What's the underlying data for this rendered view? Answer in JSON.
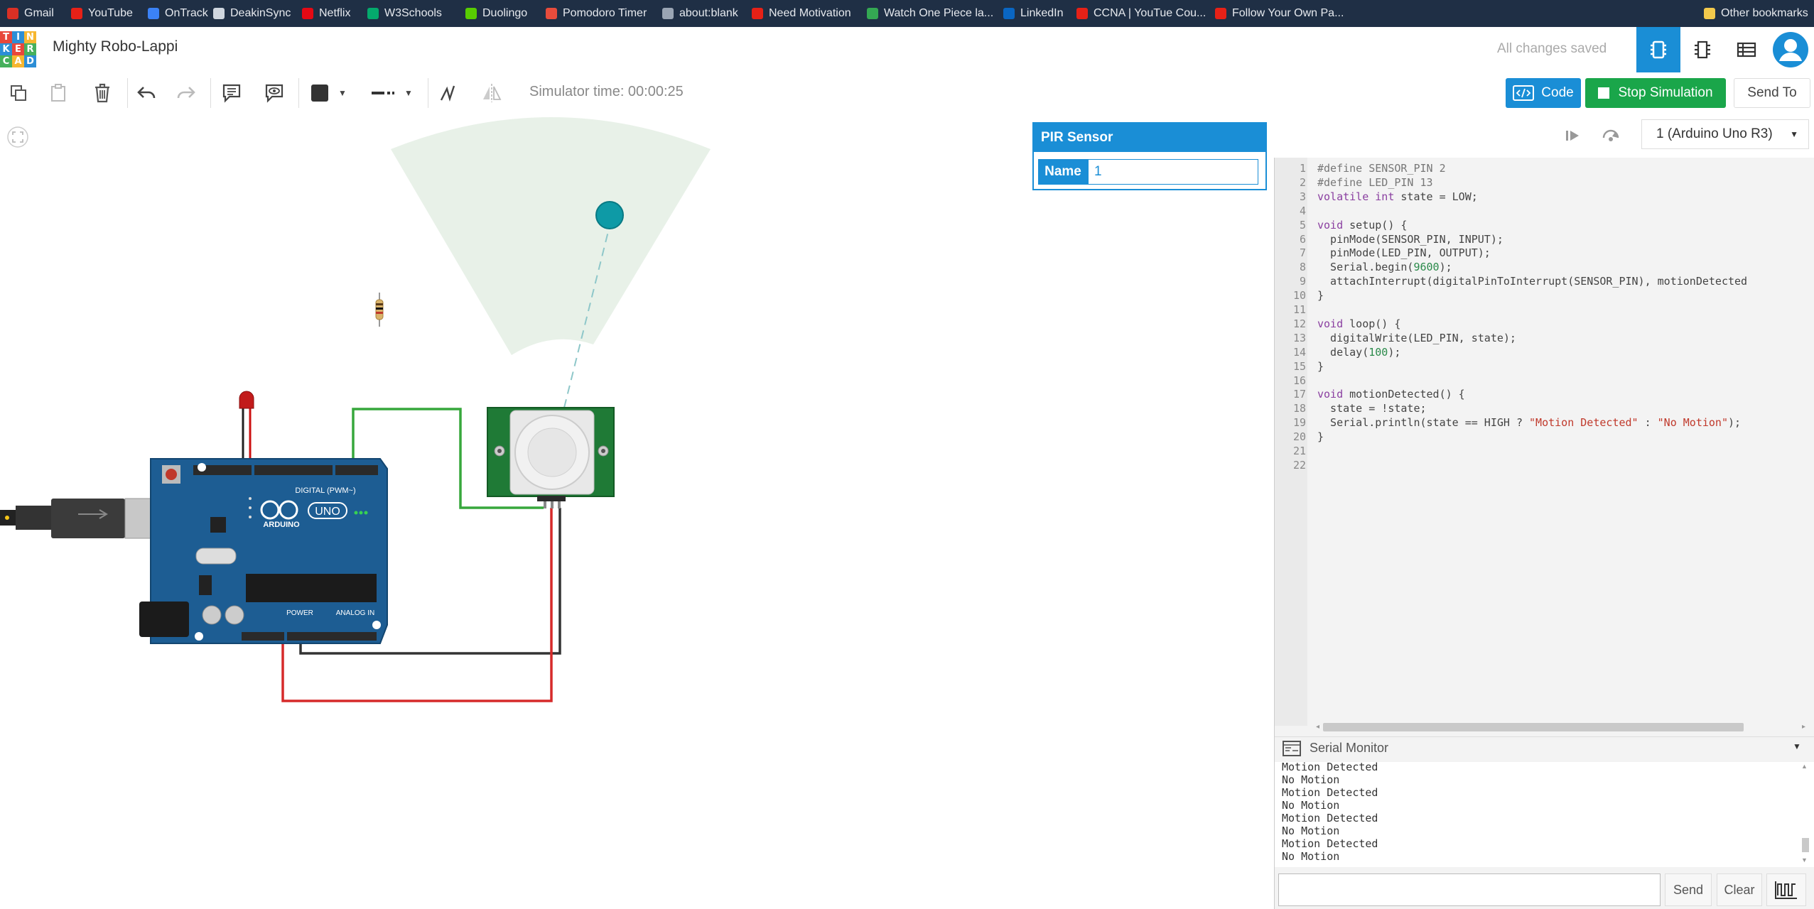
{
  "bookmarks": [
    {
      "label": "Gmail",
      "icon": "gmail-icon",
      "color": "#d93025"
    },
    {
      "label": "YouTube",
      "icon": "youtube-icon",
      "color": "#e62117"
    },
    {
      "label": "OnTrack",
      "icon": "ontrack-icon",
      "color": "#3b82f6"
    },
    {
      "label": "DeakinSync",
      "icon": "deakinsync-icon",
      "color": "#cfd6df"
    },
    {
      "label": "Netflix",
      "icon": "netflix-icon",
      "color": "#e50914"
    },
    {
      "label": "W3Schools",
      "icon": "w3schools-icon",
      "color": "#04aa6d"
    },
    {
      "label": "Duolingo",
      "icon": "duolingo-icon",
      "color": "#58cc02"
    },
    {
      "label": "Pomodoro Timer",
      "icon": "pomodoro-icon",
      "color": "#e74c3c"
    },
    {
      "label": "about:blank",
      "icon": "globe-icon",
      "color": "#9aa5b4"
    },
    {
      "label": "Need Motivation",
      "icon": "youtube-icon",
      "color": "#e62117"
    },
    {
      "label": "Watch One Piece la...",
      "icon": "bookmark-page-icon",
      "color": "#34a853"
    },
    {
      "label": "LinkedIn",
      "icon": "linkedin-icon",
      "color": "#0a66c2"
    },
    {
      "label": "CCNA | YouTue Cou...",
      "icon": "youtube-icon",
      "color": "#e62117"
    },
    {
      "label": "Follow Your Own Pa...",
      "icon": "youtube-icon",
      "color": "#e62117"
    }
  ],
  "other_bookmarks": "Other bookmarks",
  "logo_letters": [
    "T",
    "I",
    "N",
    "K",
    "E",
    "R",
    "C",
    "A",
    "D"
  ],
  "project_title": "Mighty Robo-Lappi",
  "saved_status": "All changes saved",
  "simulator_time": "Simulator time: 00:00:25",
  "buttons": {
    "code": "Code",
    "stop_simulation": "Stop Simulation",
    "send_to": "Send To"
  },
  "inspector": {
    "title": "PIR Sensor",
    "name_label": "Name",
    "name_value": "1"
  },
  "board_labels": {
    "digital": "DIGITAL (PWM~)",
    "uno": "UNO",
    "arduino": "ARDUINO",
    "power": "POWER",
    "analog": "ANALOG IN"
  },
  "device_select": "1 (Arduino Uno R3)",
  "code_lines": [
    "#define SENSOR_PIN 2",
    "#define LED_PIN 13",
    "volatile int state = LOW;",
    "",
    "void setup() {",
    "  pinMode(SENSOR_PIN, INPUT);",
    "  pinMode(LED_PIN, OUTPUT);",
    "  Serial.begin(9600);",
    "  attachInterrupt(digitalPinToInterrupt(SENSOR_PIN), motionDetected",
    "}",
    "",
    "void loop() {",
    "  digitalWrite(LED_PIN, state);",
    "  delay(100);",
    "}",
    "",
    "void motionDetected() {",
    "  state = !state;",
    "  Serial.println(state == HIGH ? \"Motion Detected\" : \"No Motion\");",
    "}",
    "",
    ""
  ],
  "serial_monitor": {
    "title": "Serial Monitor",
    "lines": [
      "Motion Detected",
      "No Motion",
      "Motion Detected",
      "No Motion",
      "Motion Detected",
      "No Motion",
      "Motion Detected",
      "No Motion"
    ],
    "send": "Send",
    "clear": "Clear"
  }
}
